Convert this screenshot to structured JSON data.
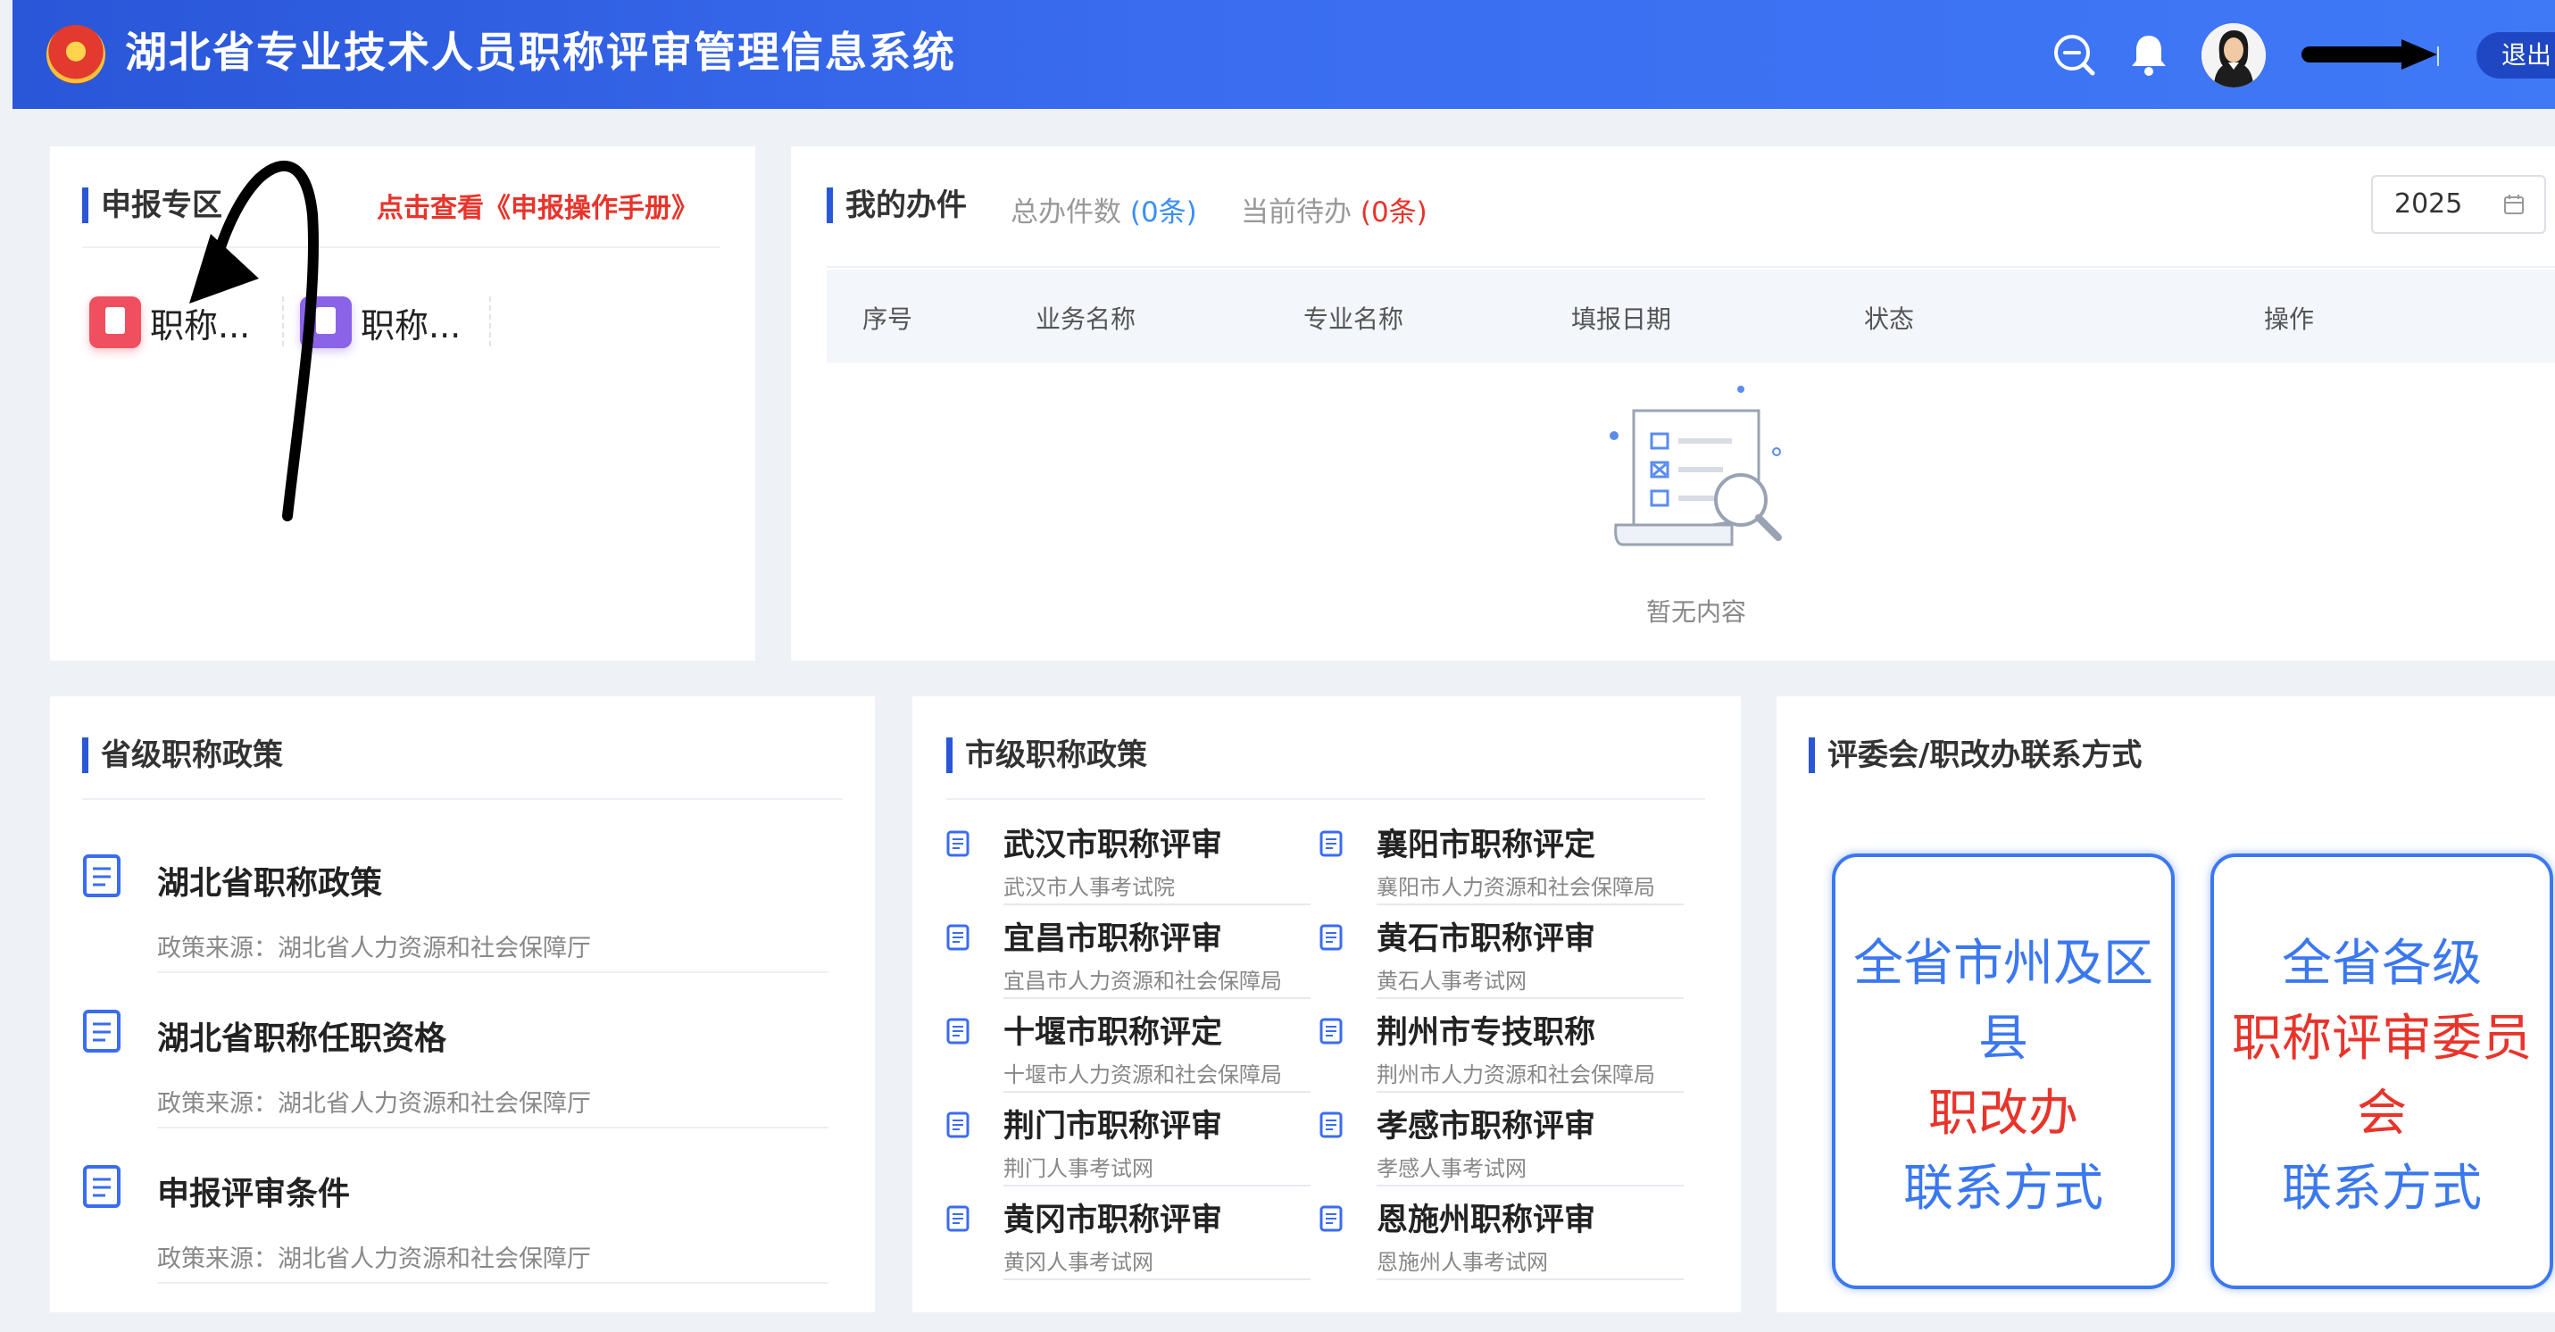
{
  "header": {
    "title": "湖北省专业技术人员职称评审管理信息系统",
    "logout_label": "退出",
    "icons": [
      "emblem-icon",
      "search-minus-icon",
      "bell-icon",
      "avatar"
    ]
  },
  "apply_zone": {
    "title": "申报专区",
    "manual_link": "点击查看《申报操作手册》",
    "items": [
      {
        "label": "职称...",
        "icon": "document-icon",
        "color": "#ef4f5f"
      },
      {
        "label": "职称...",
        "icon": "id-card-icon",
        "color": "#8a63e8"
      }
    ]
  },
  "my_cases": {
    "title": "我的办件",
    "total_label": "总办件数",
    "total_value": "(0条)",
    "pending_label": "当前待办",
    "pending_value": "(0条)",
    "year": "2025",
    "columns": [
      "序号",
      "业务名称",
      "专业名称",
      "填报日期",
      "状态",
      "操作"
    ],
    "empty_text": "暂无内容"
  },
  "provincial_policy": {
    "title": "省级职称政策",
    "items": [
      {
        "title": "湖北省职称政策",
        "source": "政策来源：湖北省人力资源和社会保障厅"
      },
      {
        "title": "湖北省职称任职资格",
        "source": "政策来源：湖北省人力资源和社会保障厅"
      },
      {
        "title": "申报评审条件",
        "source": "政策来源：湖北省人力资源和社会保障厅"
      }
    ]
  },
  "city_policy": {
    "title": "市级职称政策",
    "items": [
      {
        "title": "武汉市职称评审",
        "source": "武汉市人事考试院"
      },
      {
        "title": "襄阳市职称评定",
        "source": "襄阳市人力资源和社会保障局"
      },
      {
        "title": "宜昌市职称评审",
        "source": "宜昌市人力资源和社会保障局"
      },
      {
        "title": "黄石市职称评审",
        "source": "黄石人事考试网"
      },
      {
        "title": "十堰市职称评定",
        "source": "十堰市人力资源和社会保障局"
      },
      {
        "title": "荆州市专技职称",
        "source": "荆州市人力资源和社会保障局"
      },
      {
        "title": "荆门市职称评审",
        "source": "荆门人事考试网"
      },
      {
        "title": "孝感市职称评审",
        "source": "孝感人事考试网"
      },
      {
        "title": "黄冈市职称评审",
        "source": "黄冈人事考试网"
      },
      {
        "title": "恩施州职称评审",
        "source": "恩施州人事考试网"
      }
    ]
  },
  "contacts": {
    "title": "评委会/职改办联系方式",
    "box1": {
      "line1": "全省市州及区",
      "line2": "县",
      "line3": "职改办",
      "line4": "联系方式"
    },
    "box2": {
      "line1": "全省各级",
      "line2": "职称评审委员",
      "line3": "会",
      "line4": "联系方式"
    }
  },
  "colors": {
    "primary": "#2a56d8",
    "accent_red": "#e8342b",
    "accent_blue": "#3b78f0"
  }
}
